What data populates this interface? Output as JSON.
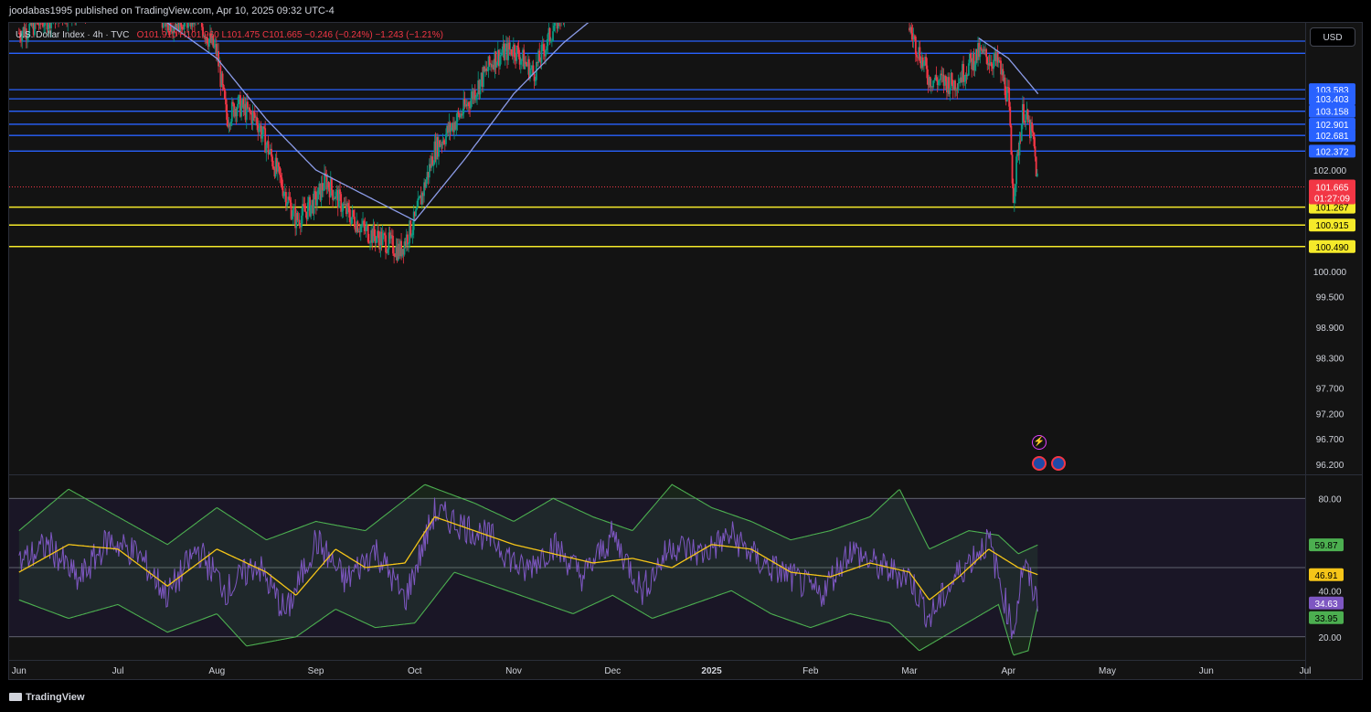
{
  "header": {
    "publisher": "joodabas1995 published on TradingView.com, Apr 10, 2025 09:32 UTC-4"
  },
  "legend": {
    "symbol": "U.S. Dollar Index · 4h · TVC",
    "open": "O101.910",
    "high": "H101.960",
    "low": "L101.475",
    "close": "C101.665",
    "change": "−0.246 (−0.24%)",
    "change2": "−1.243 (−1.21%)"
  },
  "currency_button": "USD",
  "footer": {
    "logo_text": "TradingView"
  },
  "colors": {
    "background": "#131313",
    "up": "#089981",
    "down": "#f23645",
    "blue_level": "#2962ff",
    "yellow_level": "#f5ea2a",
    "ma": "#8c9ce8",
    "rsi": "#7e57c2",
    "rsi_ma": "#f5c518",
    "band": "#4caf50"
  },
  "chart_data": [
    {
      "type": "candlestick",
      "symbol": "U.S. Dollar Index",
      "interval": "4h",
      "y_axis_ticks": [
        103.583,
        102.0,
        100.0,
        99.5,
        98.9,
        98.3,
        97.7,
        97.2,
        96.7,
        96.2
      ],
      "ylim": [
        96.0,
        104.9
      ],
      "x_ticks": [
        "Jun",
        "Jul",
        "Aug",
        "Sep",
        "Oct",
        "Nov",
        "Dec",
        "2025",
        "Feb",
        "Mar",
        "Apr",
        "May",
        "Jun",
        "Jul"
      ],
      "x_tick_months": [
        0,
        1,
        2,
        3,
        4,
        5,
        6,
        7,
        8,
        9,
        10,
        11,
        12,
        13
      ],
      "xlim_months": [
        -0.1,
        13.0
      ],
      "price_path": [
        {
          "t": 0.0,
          "p": 104.7
        },
        {
          "t": 0.4,
          "p": 105.1
        },
        {
          "t": 0.8,
          "p": 105.2
        },
        {
          "t": 1.2,
          "p": 105.6
        },
        {
          "t": 1.5,
          "p": 104.9
        },
        {
          "t": 1.8,
          "p": 105.0
        },
        {
          "t": 2.0,
          "p": 104.3
        },
        {
          "t": 2.1,
          "p": 103.0
        },
        {
          "t": 2.2,
          "p": 103.3
        },
        {
          "t": 2.4,
          "p": 103.0
        },
        {
          "t": 2.6,
          "p": 102.0
        },
        {
          "t": 2.8,
          "p": 101.0
        },
        {
          "t": 3.0,
          "p": 101.4
        },
        {
          "t": 3.1,
          "p": 101.8
        },
        {
          "t": 3.3,
          "p": 101.2
        },
        {
          "t": 3.5,
          "p": 100.8
        },
        {
          "t": 3.7,
          "p": 100.6
        },
        {
          "t": 3.85,
          "p": 100.4
        },
        {
          "t": 4.0,
          "p": 101.0
        },
        {
          "t": 4.2,
          "p": 102.4
        },
        {
          "t": 4.5,
          "p": 103.2
        },
        {
          "t": 4.8,
          "p": 104.2
        },
        {
          "t": 5.0,
          "p": 104.4
        },
        {
          "t": 5.2,
          "p": 103.9
        },
        {
          "t": 5.4,
          "p": 104.8
        },
        {
          "t": 5.6,
          "p": 105.6
        },
        {
          "t": 9.0,
          "p": 104.8
        },
        {
          "t": 9.2,
          "p": 103.8
        },
        {
          "t": 9.45,
          "p": 103.7
        },
        {
          "t": 9.7,
          "p": 104.3
        },
        {
          "t": 9.9,
          "p": 104.1
        },
        {
          "t": 10.0,
          "p": 103.4
        },
        {
          "t": 10.05,
          "p": 101.5
        },
        {
          "t": 10.1,
          "p": 102.4
        },
        {
          "t": 10.15,
          "p": 103.2
        },
        {
          "t": 10.25,
          "p": 102.6
        },
        {
          "t": 10.3,
          "p": 101.66
        }
      ],
      "moving_average": [
        {
          "t": 1.5,
          "p": 104.9
        },
        {
          "t": 2.0,
          "p": 104.2
        },
        {
          "t": 2.5,
          "p": 103.0
        },
        {
          "t": 3.0,
          "p": 102.0
        },
        {
          "t": 3.5,
          "p": 101.5
        },
        {
          "t": 4.0,
          "p": 101.0
        },
        {
          "t": 4.5,
          "p": 102.2
        },
        {
          "t": 5.0,
          "p": 103.5
        },
        {
          "t": 5.5,
          "p": 104.5
        },
        {
          "t": 6.0,
          "p": 105.3
        },
        {
          "t": 9.7,
          "p": 104.6
        },
        {
          "t": 10.0,
          "p": 104.2
        },
        {
          "t": 10.3,
          "p": 103.5
        }
      ],
      "levels_blue": [
        104.54,
        104.3,
        103.583,
        103.403,
        103.158,
        102.901,
        102.681,
        102.372
      ],
      "levels_yellow": [
        101.267,
        100.915,
        100.49
      ],
      "price_labels": {
        "last": "101.665",
        "countdown": "01:27:09"
      },
      "level_labels": [
        "103.583",
        "103.403",
        "103.158",
        "102.901",
        "102.681",
        "102.372",
        "101.267",
        "100.915",
        "100.490"
      ]
    },
    {
      "type": "line",
      "title": "RSI",
      "ylim": [
        10,
        90
      ],
      "y_axis_ticks": [
        80.0,
        40.0,
        20.0
      ],
      "bands": [
        80,
        50,
        20
      ],
      "rsi_path": [
        {
          "t": 0.0,
          "v": 52
        },
        {
          "t": 0.3,
          "v": 60
        },
        {
          "t": 0.6,
          "v": 44
        },
        {
          "t": 0.9,
          "v": 62
        },
        {
          "t": 1.2,
          "v": 56
        },
        {
          "t": 1.5,
          "v": 38
        },
        {
          "t": 1.8,
          "v": 58
        },
        {
          "t": 2.1,
          "v": 40
        },
        {
          "t": 2.4,
          "v": 52
        },
        {
          "t": 2.7,
          "v": 30
        },
        {
          "t": 3.0,
          "v": 62
        },
        {
          "t": 3.3,
          "v": 44
        },
        {
          "t": 3.6,
          "v": 58
        },
        {
          "t": 3.9,
          "v": 36
        },
        {
          "t": 4.2,
          "v": 74
        },
        {
          "t": 4.5,
          "v": 68
        },
        {
          "t": 4.8,
          "v": 62
        },
        {
          "t": 5.1,
          "v": 48
        },
        {
          "t": 5.4,
          "v": 60
        },
        {
          "t": 5.7,
          "v": 46
        },
        {
          "t": 6.0,
          "v": 64
        },
        {
          "t": 6.3,
          "v": 40
        },
        {
          "t": 6.6,
          "v": 60
        },
        {
          "t": 6.9,
          "v": 56
        },
        {
          "t": 7.2,
          "v": 64
        },
        {
          "t": 7.5,
          "v": 52
        },
        {
          "t": 7.8,
          "v": 46
        },
        {
          "t": 8.1,
          "v": 38
        },
        {
          "t": 8.4,
          "v": 58
        },
        {
          "t": 8.7,
          "v": 50
        },
        {
          "t": 9.0,
          "v": 46
        },
        {
          "t": 9.2,
          "v": 28
        },
        {
          "t": 9.5,
          "v": 48
        },
        {
          "t": 9.8,
          "v": 62
        },
        {
          "t": 10.05,
          "v": 22
        },
        {
          "t": 10.15,
          "v": 52
        },
        {
          "t": 10.3,
          "v": 34.63
        }
      ],
      "rsi_ma_path": [
        {
          "t": 0.0,
          "v": 48
        },
        {
          "t": 0.5,
          "v": 60
        },
        {
          "t": 1.0,
          "v": 58
        },
        {
          "t": 1.5,
          "v": 42
        },
        {
          "t": 2.0,
          "v": 58
        },
        {
          "t": 2.5,
          "v": 48
        },
        {
          "t": 2.8,
          "v": 38
        },
        {
          "t": 3.2,
          "v": 58
        },
        {
          "t": 3.5,
          "v": 50
        },
        {
          "t": 3.9,
          "v": 52
        },
        {
          "t": 4.2,
          "v": 72
        },
        {
          "t": 4.6,
          "v": 66
        },
        {
          "t": 5.0,
          "v": 60
        },
        {
          "t": 5.4,
          "v": 56
        },
        {
          "t": 5.8,
          "v": 52
        },
        {
          "t": 6.2,
          "v": 54
        },
        {
          "t": 6.6,
          "v": 50
        },
        {
          "t": 7.0,
          "v": 60
        },
        {
          "t": 7.4,
          "v": 58
        },
        {
          "t": 7.8,
          "v": 48
        },
        {
          "t": 8.2,
          "v": 46
        },
        {
          "t": 8.6,
          "v": 52
        },
        {
          "t": 9.0,
          "v": 48
        },
        {
          "t": 9.2,
          "v": 36
        },
        {
          "t": 9.5,
          "v": 46
        },
        {
          "t": 9.8,
          "v": 58
        },
        {
          "t": 10.1,
          "v": 50
        },
        {
          "t": 10.3,
          "v": 46.91
        }
      ],
      "band_upper_path": [
        {
          "t": 0.0,
          "v": 66
        },
        {
          "t": 0.5,
          "v": 84
        },
        {
          "t": 1.0,
          "v": 72
        },
        {
          "t": 1.5,
          "v": 60
        },
        {
          "t": 2.0,
          "v": 76
        },
        {
          "t": 2.5,
          "v": 62
        },
        {
          "t": 3.0,
          "v": 70
        },
        {
          "t": 3.5,
          "v": 66
        },
        {
          "t": 4.1,
          "v": 86
        },
        {
          "t": 4.6,
          "v": 78
        },
        {
          "t": 5.0,
          "v": 70
        },
        {
          "t": 5.4,
          "v": 80
        },
        {
          "t": 5.8,
          "v": 72
        },
        {
          "t": 6.2,
          "v": 66
        },
        {
          "t": 6.6,
          "v": 86
        },
        {
          "t": 7.0,
          "v": 76
        },
        {
          "t": 7.4,
          "v": 70
        },
        {
          "t": 7.8,
          "v": 62
        },
        {
          "t": 8.2,
          "v": 66
        },
        {
          "t": 8.6,
          "v": 72
        },
        {
          "t": 8.9,
          "v": 84
        },
        {
          "t": 9.2,
          "v": 58
        },
        {
          "t": 9.6,
          "v": 66
        },
        {
          "t": 9.9,
          "v": 64
        },
        {
          "t": 10.1,
          "v": 56
        },
        {
          "t": 10.3,
          "v": 59.87
        }
      ],
      "band_lower_path": [
        {
          "t": 0.0,
          "v": 36
        },
        {
          "t": 0.5,
          "v": 28
        },
        {
          "t": 1.0,
          "v": 34
        },
        {
          "t": 1.5,
          "v": 22
        },
        {
          "t": 2.0,
          "v": 30
        },
        {
          "t": 2.3,
          "v": 16
        },
        {
          "t": 2.8,
          "v": 20
        },
        {
          "t": 3.2,
          "v": 32
        },
        {
          "t": 3.6,
          "v": 24
        },
        {
          "t": 4.0,
          "v": 26
        },
        {
          "t": 4.4,
          "v": 48
        },
        {
          "t": 4.8,
          "v": 42
        },
        {
          "t": 5.2,
          "v": 36
        },
        {
          "t": 5.6,
          "v": 30
        },
        {
          "t": 6.0,
          "v": 38
        },
        {
          "t": 6.4,
          "v": 28
        },
        {
          "t": 6.8,
          "v": 34
        },
        {
          "t": 7.2,
          "v": 40
        },
        {
          "t": 7.6,
          "v": 30
        },
        {
          "t": 8.0,
          "v": 24
        },
        {
          "t": 8.4,
          "v": 30
        },
        {
          "t": 8.8,
          "v": 26
        },
        {
          "t": 9.1,
          "v": 14
        },
        {
          "t": 9.5,
          "v": 24
        },
        {
          "t": 9.9,
          "v": 34
        },
        {
          "t": 10.05,
          "v": 12
        },
        {
          "t": 10.2,
          "v": 14
        },
        {
          "t": 10.3,
          "v": 33.95
        }
      ],
      "value_labels": [
        "59.87",
        "46.91",
        "34.63",
        "33.95"
      ]
    }
  ]
}
